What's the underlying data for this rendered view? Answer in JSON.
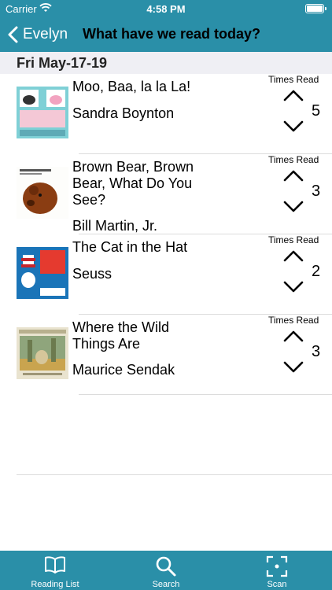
{
  "status_bar": {
    "carrier": "Carrier",
    "time": "4:58 PM"
  },
  "nav": {
    "back_label": "Evelyn",
    "title": "What have we read today?"
  },
  "section": {
    "date": "Fri May-17-19"
  },
  "books": [
    {
      "title": "Moo, Baa, la la La!",
      "author": "Sandra Boynton",
      "times_read_label": "Times Read",
      "count": "5"
    },
    {
      "title": "Brown Bear, Brown Bear, What Do You See?",
      "author": "Bill Martin, Jr.",
      "times_read_label": "Times Read",
      "count": "3"
    },
    {
      "title": "The Cat in the Hat",
      "author": "Seuss",
      "times_read_label": "Times Read",
      "count": "2"
    },
    {
      "title": "Where the Wild Things Are",
      "author": "Maurice Sendak",
      "times_read_label": "Times Read",
      "count": "3"
    }
  ],
  "tabs": [
    {
      "label": "Reading List",
      "icon": "book-icon"
    },
    {
      "label": "Search",
      "icon": "search-icon"
    },
    {
      "label": "Scan",
      "icon": "scan-icon"
    }
  ],
  "colors": {
    "bar": "#2a8fa8",
    "header_bg": "#efeff4"
  }
}
